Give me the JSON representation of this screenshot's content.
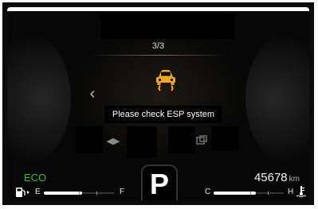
{
  "cluster": {
    "page_indicator": "3/3",
    "message": "Please check ESP system",
    "prev_arrow": "‹",
    "warning_icon": "esp-skid-icon",
    "drive_mode": "ECO",
    "odometer": {
      "value": "45678",
      "unit": "km"
    },
    "gear": "P",
    "fuel": {
      "empty_label": "E",
      "full_label": "F",
      "level_fraction": 0.55,
      "icon": "fuel-pump-icon"
    },
    "temperature": {
      "cold_label": "C",
      "hot_label": "H",
      "level_fraction": 0.6,
      "icon": "coolant-temp-icon"
    },
    "colors": {
      "eco": "#2fc12f",
      "warning": "#f2a81d",
      "text": "#ffffff"
    }
  }
}
